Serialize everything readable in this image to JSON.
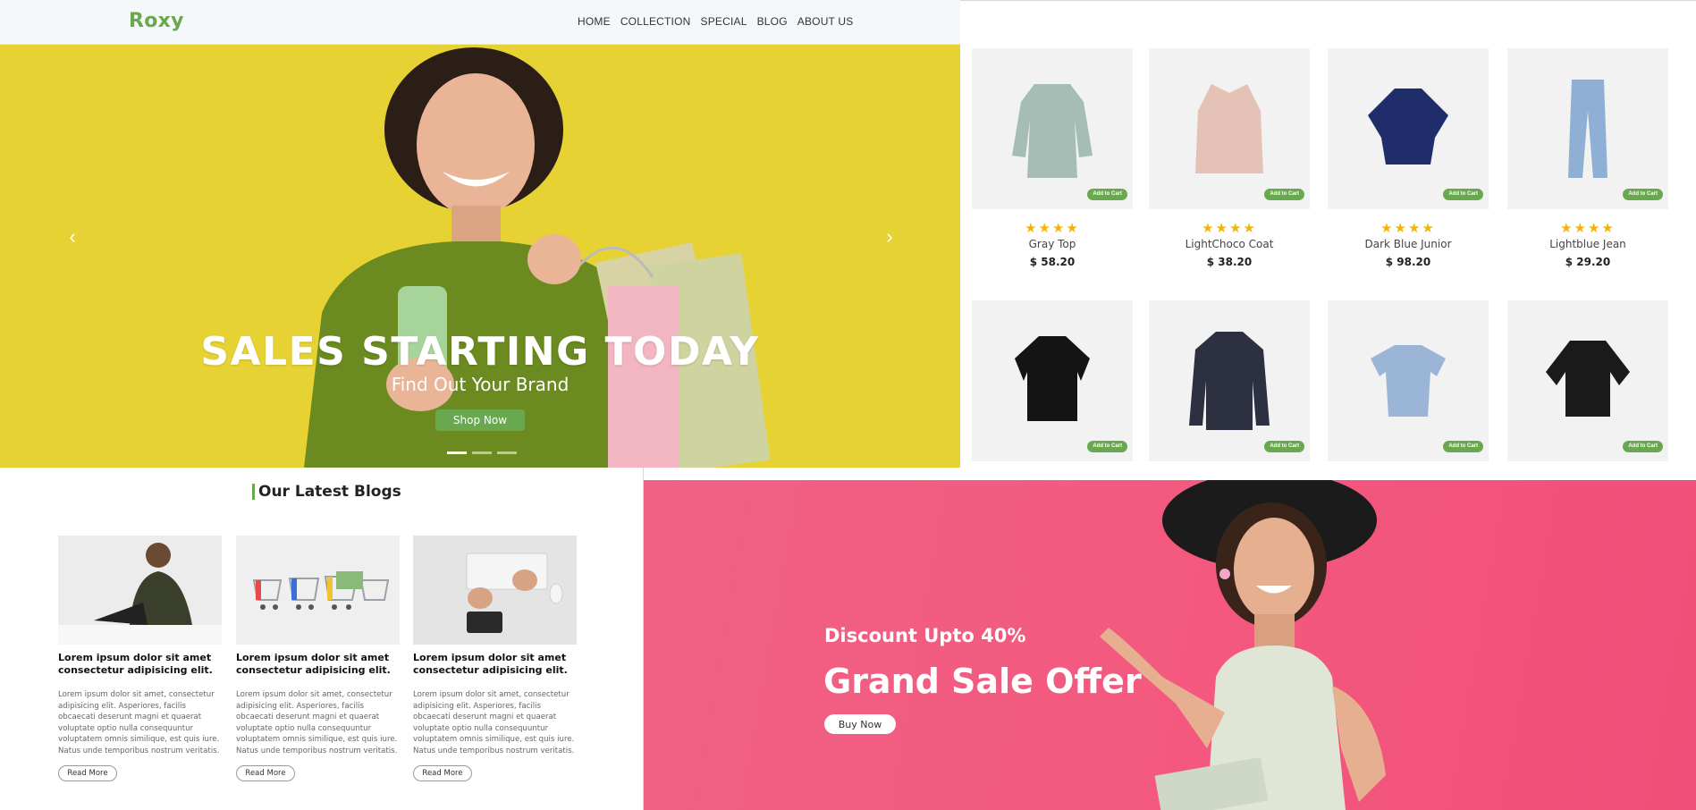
{
  "site": {
    "logo": "Roxy",
    "nav": [
      "HOME",
      "COLLECTION",
      "SPECIAL",
      "BLOG",
      "ABOUT US"
    ]
  },
  "hero": {
    "title": "SALES STARTING TODAY",
    "subtitle": "Find Out Your Brand",
    "button": "Shop Now",
    "prev_icon": "chevron-left-icon",
    "next_icon": "chevron-right-icon",
    "slides": 3,
    "active_slide": 1,
    "background_color": "#e7d234"
  },
  "products": {
    "cart_label": "Add to Cart",
    "accent": "#6aa84f",
    "star_color": "#f4b400",
    "items": [
      {
        "name": "Gray Top",
        "price": "$ 58.20",
        "stars": "★★★★",
        "icon": "blouse-icon"
      },
      {
        "name": "LightChoco Coat",
        "price": "$ 38.20",
        "stars": "★★★★",
        "icon": "vest-icon"
      },
      {
        "name": "Dark Blue Junior",
        "price": "$ 98.20",
        "stars": "★★★★",
        "icon": "ruffle-top-icon"
      },
      {
        "name": "Lightblue Jean",
        "price": "$ 29.20",
        "stars": "★★★★",
        "icon": "jeans-icon"
      },
      {
        "name": "",
        "price": "",
        "stars": "",
        "icon": "black-shirt-icon"
      },
      {
        "name": "",
        "price": "",
        "stars": "",
        "icon": "jacket-icon"
      },
      {
        "name": "",
        "price": "",
        "stars": "",
        "icon": "crop-top-icon"
      },
      {
        "name": "",
        "price": "",
        "stars": "",
        "icon": "black-blouse-icon"
      }
    ]
  },
  "blogs": {
    "heading": "Our Latest Blogs",
    "items": [
      {
        "title": "Lorem ipsum dolor sit amet consectetur adipisicing elit.",
        "text": "Lorem ipsum dolor sit amet, consectetur adipisicing elit. Asperiores, facilis obcaecati deserunt magni et quaerat voluptate optio nulla consequuntur voluptatem omnis similique, est quis iure. Natus unde temporibus nostrum veritatis.",
        "button": "Read More",
        "image": "man-laptop-image"
      },
      {
        "title": "Lorem ipsum dolor sit amet consectetur adipisicing elit.",
        "text": "Lorem ipsum dolor sit amet, consectetur adipisicing elit. Asperiores, facilis obcaecati deserunt magni et quaerat voluptate optio nulla consequuntur voluptatem omnis similique, est quis iure. Natus unde temporibus nostrum veritatis.",
        "button": "Read More",
        "image": "shopping-carts-image"
      },
      {
        "title": "Lorem ipsum dolor sit amet consectetur adipisicing elit.",
        "text": "Lorem ipsum dolor sit amet, consectetur adipisicing elit. Asperiores, facilis obcaecati deserunt magni et quaerat voluptate optio nulla consequuntur voluptatem omnis similique, est quis iure. Natus unde temporibus nostrum veritatis.",
        "button": "Read More",
        "image": "keyboard-wallet-image"
      }
    ]
  },
  "sale": {
    "discount": "Discount Upto 40%",
    "title": "Grand Sale Offer",
    "button": "Buy Now",
    "background_color": "#f4587e"
  }
}
